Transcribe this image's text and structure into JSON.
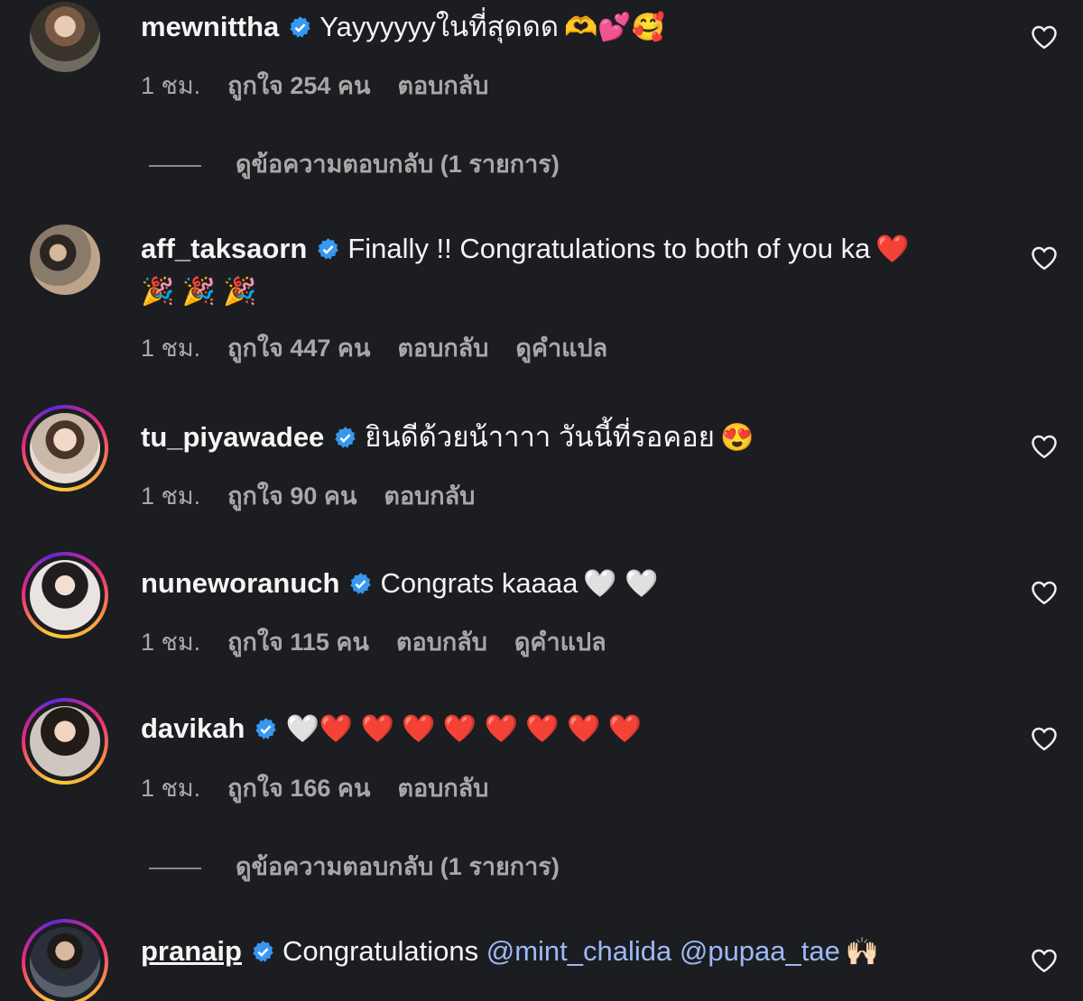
{
  "comments": [
    {
      "username": "mewnittha",
      "text": "Yayyyyyyในที่สุดดด",
      "emojis": "🫶💕🥰",
      "time": "1 ชม.",
      "likes": "ถูกใจ 254 คน",
      "reply": "ตอบกลับ",
      "translate": ""
    },
    {
      "username": "aff_taksaorn",
      "text": "Finally !! Congratulations to both of you ka",
      "emojis": "❤️",
      "emojis_line2": "🎉 🎉 🎉",
      "time": "1 ชม.",
      "likes": "ถูกใจ 447 คน",
      "reply": "ตอบกลับ",
      "translate": "ดูคำแปล"
    },
    {
      "username": "tu_piyawadee",
      "text": "ยินดีด้วยน้าาาา วันนี้ที่รอคอย",
      "emojis": "😍",
      "time": "1 ชม.",
      "likes": "ถูกใจ 90 คน",
      "reply": "ตอบกลับ",
      "translate": ""
    },
    {
      "username": "nuneworanuch",
      "text": "Congrats kaaaa",
      "emojis": "🤍 🤍",
      "time": "1 ชม.",
      "likes": "ถูกใจ 115 คน",
      "reply": "ตอบกลับ",
      "translate": "ดูคำแปล"
    },
    {
      "username": "davikah",
      "text": "",
      "emojis": "🤍❤️ ❤️ ❤️ ❤️ ❤️ ❤️ ❤️ ❤️",
      "time": "1 ชม.",
      "likes": "ถูกใจ 166 คน",
      "reply": "ตอบกลับ",
      "translate": ""
    },
    {
      "username": "pranaip",
      "text": "Congratulations",
      "mentions": "@mint_chalida @pupaa_tae",
      "emojis": "🙌🏻",
      "time": "",
      "likes": "",
      "reply": "",
      "translate": ""
    }
  ],
  "view_replies": [
    "ดูข้อความตอบกลับ (1 รายการ)",
    "ดูข้อความตอบกลับ (1 รายการ)"
  ],
  "colors": {
    "background": "#1b1d21",
    "verified": "#3897f0",
    "meta": "#a8a8a8",
    "mention": "#9eb8f5"
  },
  "icons": {
    "verified": "verified-badge-icon",
    "like": "heart-outline-icon"
  }
}
